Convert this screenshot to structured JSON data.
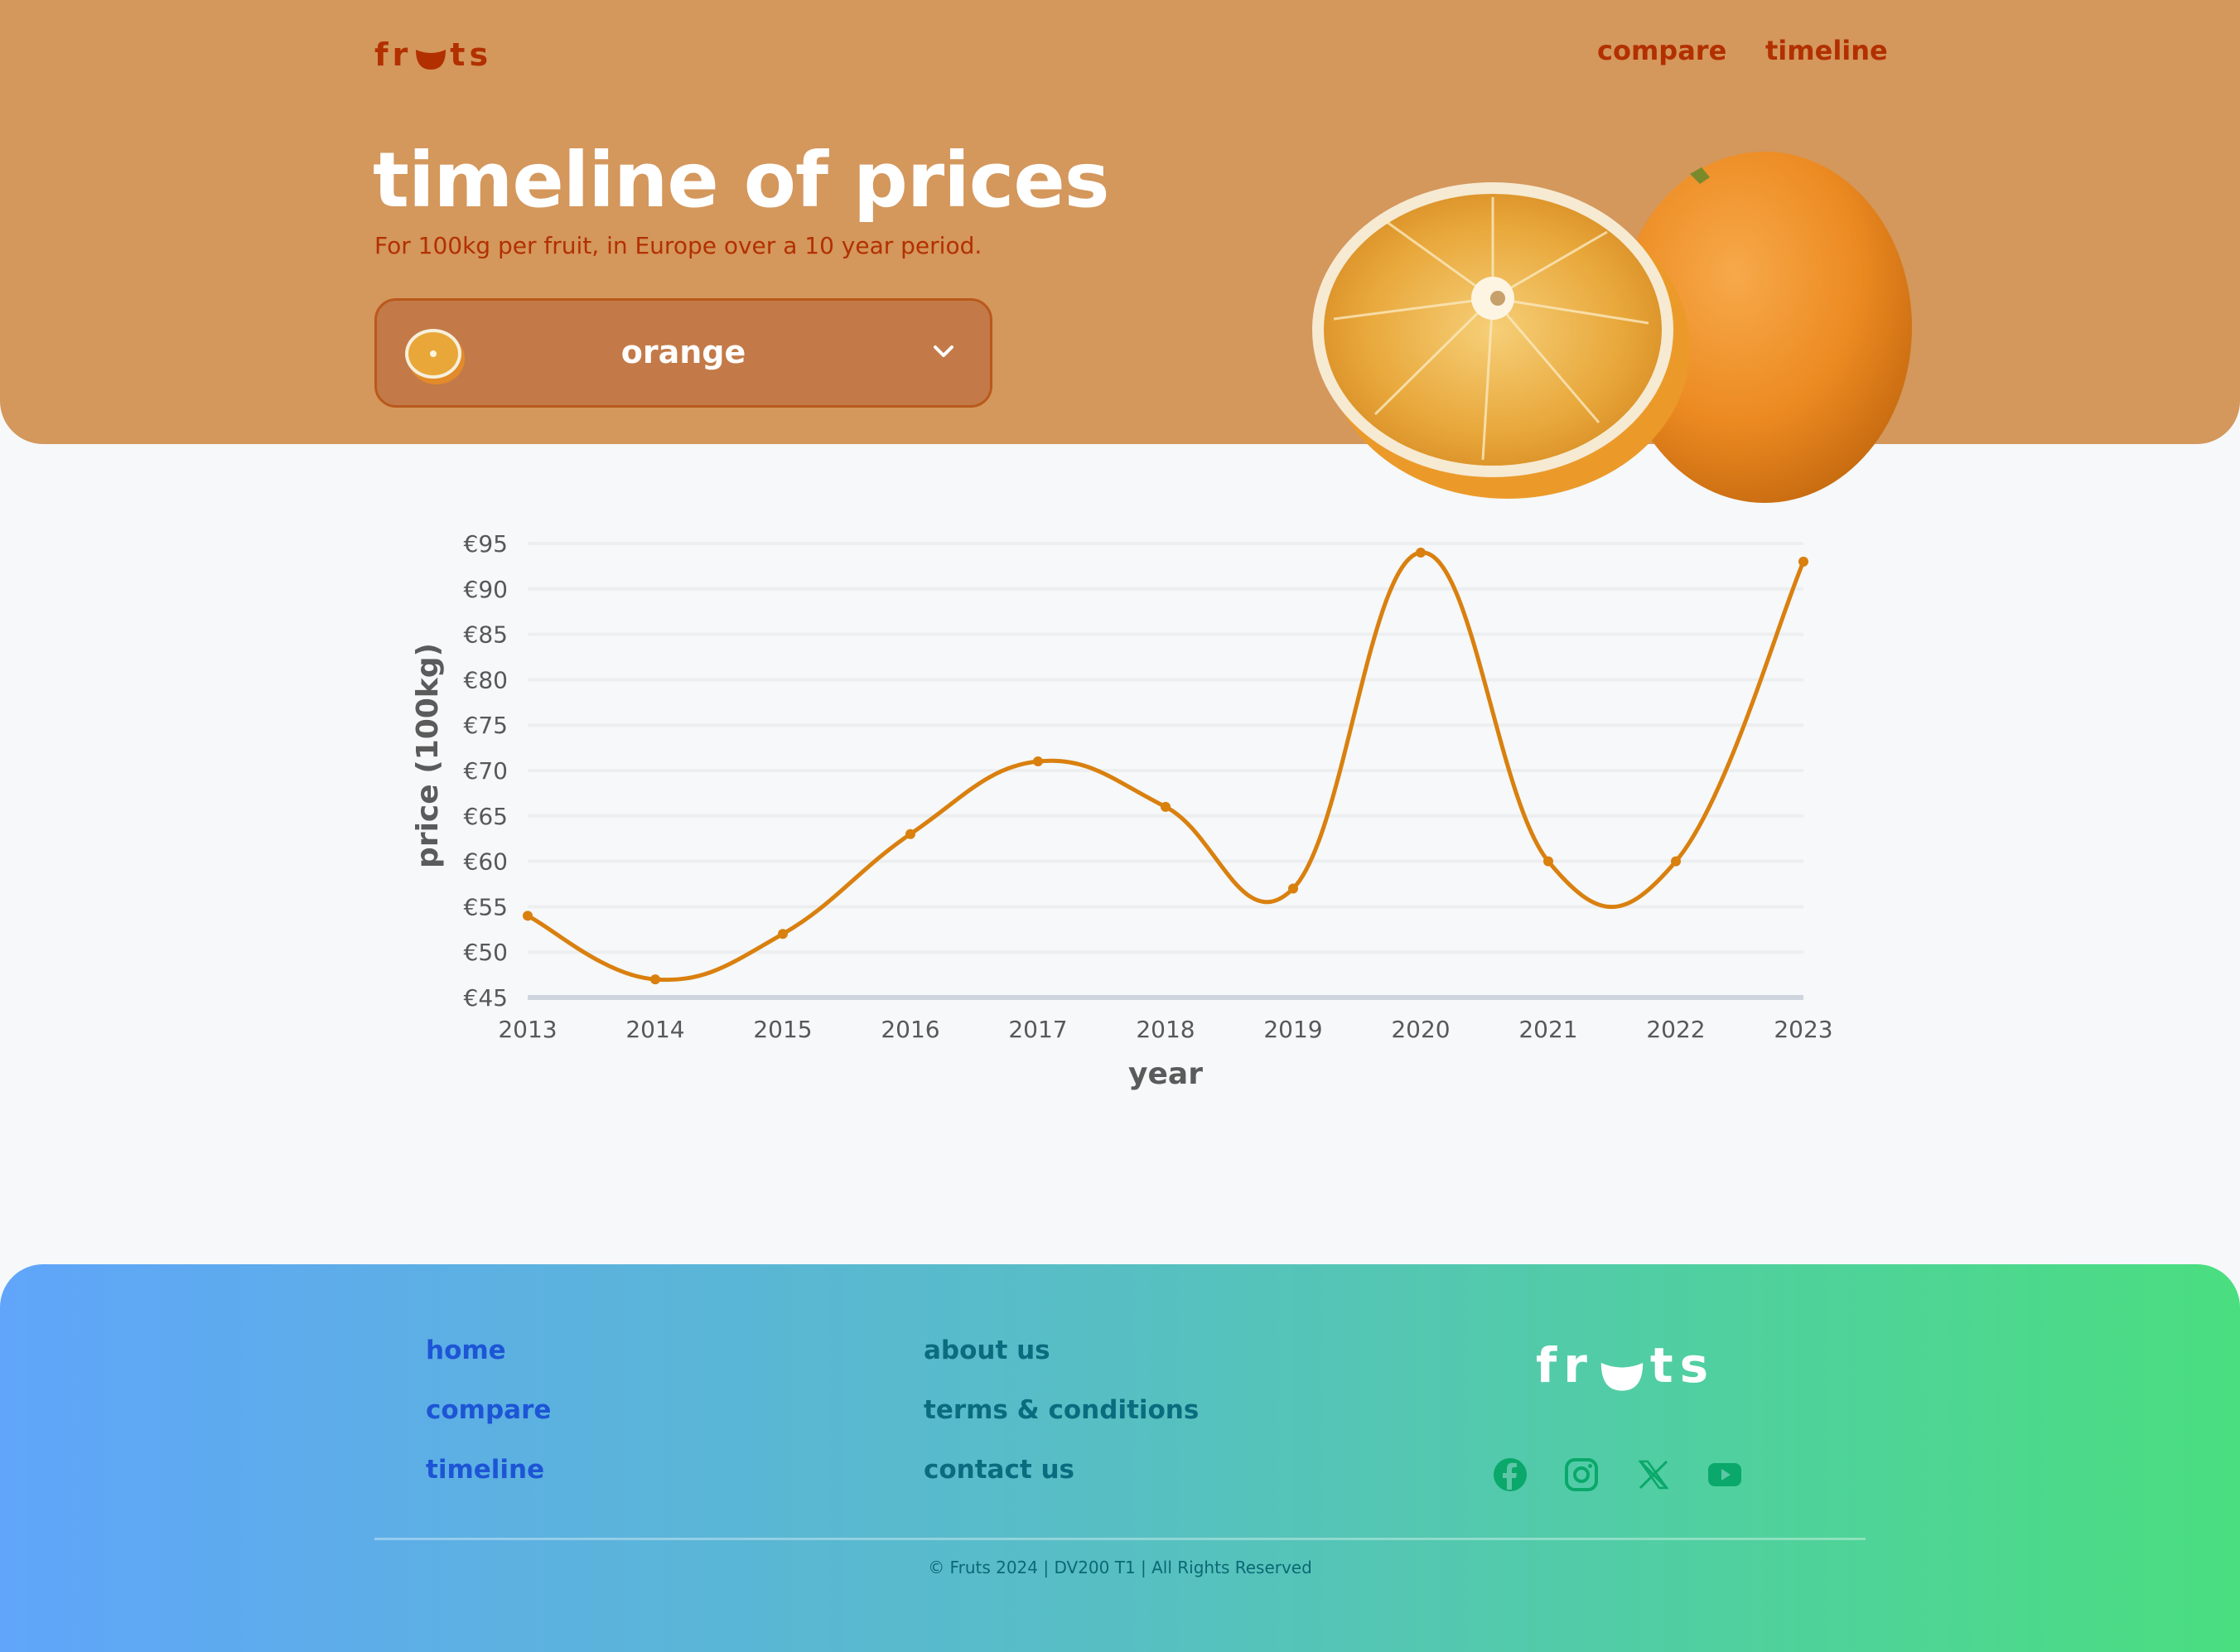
{
  "brand": {
    "logo_text": "fruts"
  },
  "nav": {
    "compare": "compare",
    "timeline": "timeline"
  },
  "hero": {
    "title": "timeline of prices",
    "subtitle": "For 100kg per fruit, in Europe over a 10 year period.",
    "fruit_select": {
      "selected": "orange"
    }
  },
  "colors": {
    "hero_bg": "#d4975c",
    "accent_text": "#b23000",
    "line": "#d9800f",
    "footer_gradient": [
      "#60a5fa",
      "#4ade80"
    ]
  },
  "chart_data": {
    "type": "line",
    "x": [
      2013,
      2014,
      2015,
      2016,
      2017,
      2018,
      2019,
      2020,
      2021,
      2022,
      2023
    ],
    "series": [
      {
        "values": [
          54,
          47,
          52,
          63,
          71,
          66,
          57,
          94,
          60,
          60,
          93
        ]
      }
    ],
    "xlabel": "year",
    "ylabel": "price (100kg)",
    "ylim": [
      45,
      95
    ],
    "yticks": [
      45,
      50,
      55,
      60,
      65,
      70,
      75,
      80,
      85,
      90,
      95
    ],
    "ytick_prefix": "€",
    "grid": true,
    "smooth": true,
    "color": "#d9800f"
  },
  "footer": {
    "col1": [
      "home",
      "compare",
      "timeline"
    ],
    "col2": [
      "about us",
      "terms & conditions",
      "contact us"
    ],
    "social_icons": [
      "facebook-icon",
      "instagram-icon",
      "x-icon",
      "youtube-icon"
    ],
    "copyright": "© Fruts 2024 | DV200 T1 | All Rights Reserved"
  }
}
